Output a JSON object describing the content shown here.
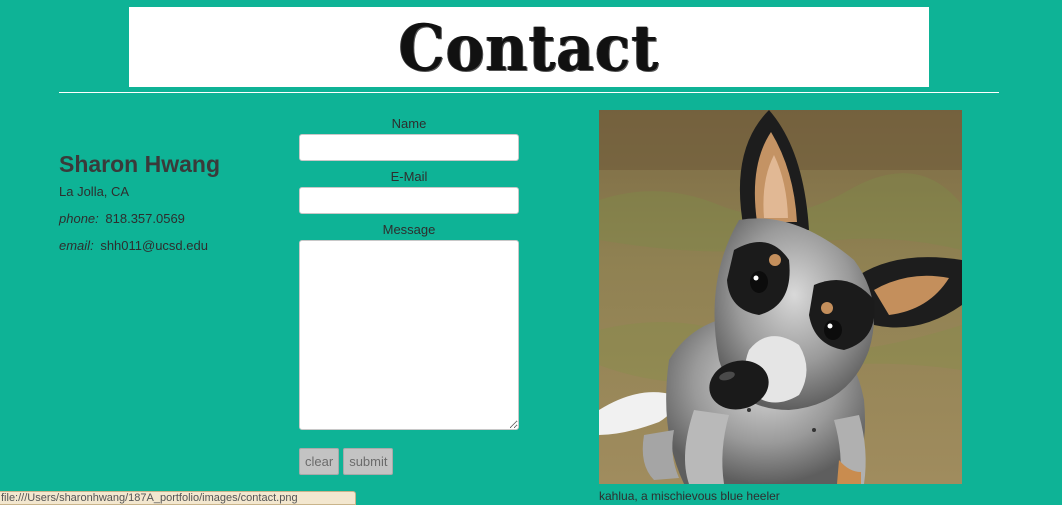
{
  "banner": {
    "title": "Contact"
  },
  "contact": {
    "name": "Sharon Hwang",
    "location": "La Jolla, CA",
    "phone_label": "phone:",
    "phone": "818.357.0569",
    "email_label": "email:",
    "email": "shh011@ucsd.edu"
  },
  "form": {
    "name_label": "Name",
    "name_value": "",
    "email_label": "E-Mail",
    "email_value": "",
    "message_label": "Message",
    "message_value": "",
    "clear_label": "clear",
    "submit_label": "submit"
  },
  "photo": {
    "caption": "kahlua, a mischievous blue heeler"
  },
  "status_bar": {
    "url": "file:///Users/sharonhwang/187A_portfolio/images/contact.png"
  },
  "colors": {
    "background": "#0eb396",
    "banner": "#ffffff",
    "text": "#333333"
  }
}
